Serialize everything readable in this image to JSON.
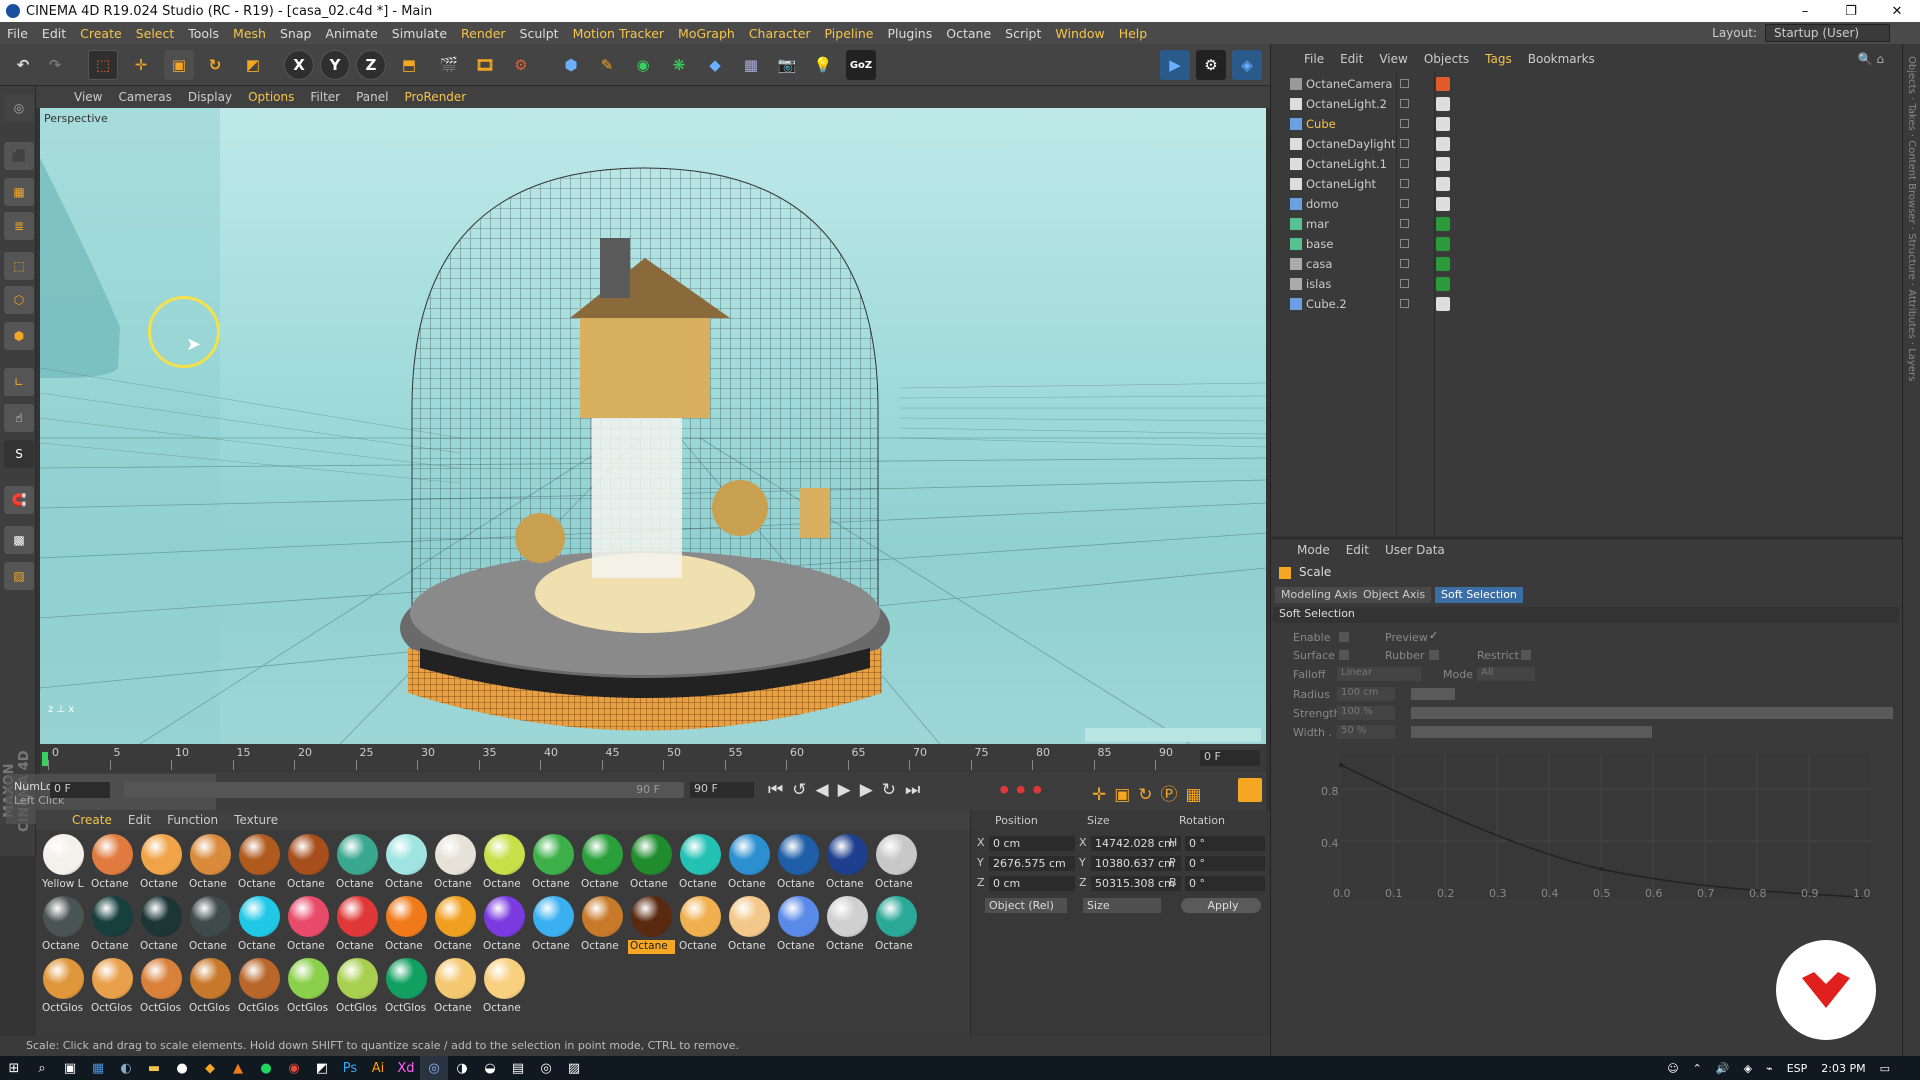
{
  "window": {
    "title": "CINEMA 4D R19.024 Studio (RC - R19) - [casa_02.c4d *] - Main",
    "min": "–",
    "max": "❐",
    "close": "✕"
  },
  "menu": [
    "File",
    "Edit",
    "Create",
    "Select",
    "Tools",
    "Mesh",
    "Snap",
    "Animate",
    "Simulate",
    "Render",
    "Sculpt",
    "Motion Tracker",
    "MoGraph",
    "Character",
    "Pipeline",
    "Plugins",
    "Octane",
    "Script",
    "Window",
    "Help"
  ],
  "layout": {
    "label": "Layout:",
    "value": "Startup (User)"
  },
  "toolbar": {
    "x": "X",
    "y": "Y",
    "z": "Z"
  },
  "viewport": {
    "menu": [
      "View",
      "Cameras",
      "Display",
      "Options",
      "Filter",
      "Panel",
      "ProRender"
    ],
    "label": "Perspective"
  },
  "timeline": {
    "ticks": [
      "0",
      "5",
      "10",
      "15",
      "20",
      "25",
      "30",
      "35",
      "40",
      "45",
      "50",
      "55",
      "60",
      "65",
      "70",
      "75",
      "80",
      "85",
      "90"
    ],
    "frame_field": "0 F",
    "start_field": "0 F",
    "end_field": "90 F",
    "end_field2": "90 F",
    "numlock": "NumLock",
    "leftclick": "Left Click"
  },
  "materials": {
    "menu": [
      "Create",
      "Edit",
      "Function",
      "Texture"
    ],
    "rows": [
      [
        {
          "n": "Yellow L",
          "c": "#f4f0ea"
        },
        {
          "n": "Octane",
          "c": "#e07a3e"
        },
        {
          "n": "Octane",
          "c": "#f0a347"
        },
        {
          "n": "Octane",
          "c": "#d98a3a"
        },
        {
          "n": "Octane",
          "c": "#b05a1e"
        },
        {
          "n": "Octane",
          "c": "#a74e1c"
        },
        {
          "n": "Octane",
          "c": "#3aa890"
        },
        {
          "n": "Octane",
          "c": "#9fe4e2"
        },
        {
          "n": "Octane",
          "c": "#e6e2d8"
        },
        {
          "n": "Octane",
          "c": "#c7e04a"
        },
        {
          "n": "Octane",
          "c": "#3db04a"
        },
        {
          "n": "Octane",
          "c": "#2aa03a"
        },
        {
          "n": "Octane",
          "c": "#1f8c2e"
        },
        {
          "n": "Octane",
          "c": "#23c2b4"
        },
        {
          "n": "Octane",
          "c": "#2b8fd0"
        },
        {
          "n": "Octane",
          "c": "#1f5ea8"
        },
        {
          "n": "Octane",
          "c": "#1d3f8e"
        },
        {
          "n": "Octane",
          "c": "#c8c8c8"
        }
      ],
      [
        {
          "n": "Octane",
          "c": "#4a5452"
        },
        {
          "n": "Octane",
          "c": "#163f3e"
        },
        {
          "n": "Octane",
          "c": "#1b3635"
        },
        {
          "n": "Octane",
          "c": "#3f4a4a"
        },
        {
          "n": "Octane",
          "c": "#20c8e6"
        },
        {
          "n": "Octane",
          "c": "#e84a6a"
        },
        {
          "n": "Octane",
          "c": "#e03838"
        },
        {
          "n": "Octane",
          "c": "#f07a1a"
        },
        {
          "n": "Octane",
          "c": "#f0a020"
        },
        {
          "n": "Octane",
          "c": "#7a3ae0"
        },
        {
          "n": "Octane",
          "c": "#3ab0f0"
        },
        {
          "n": "Octane",
          "c": "#c87a2a"
        },
        {
          "n": "Octane",
          "c": "#5a2a10",
          "sel": true
        },
        {
          "n": "Octane",
          "c": "#f0b050"
        },
        {
          "n": "Octane",
          "c": "#f4c88a"
        },
        {
          "n": "Octane",
          "c": "#5a8ae8"
        },
        {
          "n": "Octane",
          "c": "#d0d0d0"
        },
        {
          "n": "Octane",
          "c": "#2aa898"
        }
      ],
      [
        {
          "n": "OctGlos",
          "c": "#e0963a"
        },
        {
          "n": "OctGlos",
          "c": "#e8a04a"
        },
        {
          "n": "OctGlos",
          "c": "#d9803a"
        },
        {
          "n": "OctGlos",
          "c": "#c8782a"
        },
        {
          "n": "OctGlos",
          "c": "#b8662a"
        },
        {
          "n": "OctGlos",
          "c": "#8ad04a"
        },
        {
          "n": "OctGlos",
          "c": "#a8d050"
        },
        {
          "n": "OctGlos",
          "c": "#12a060"
        },
        {
          "n": "Octane",
          "c": "#f4c870"
        },
        {
          "n": "Octane",
          "c": "#f8d080"
        }
      ]
    ]
  },
  "coords": {
    "headers": [
      "Position",
      "Size",
      "Rotation"
    ],
    "rows": [
      {
        "a": "X",
        "pos": "0 cm",
        "b": "X",
        "size": "14742.028 cm",
        "c": "H",
        "rot": "0 °"
      },
      {
        "a": "Y",
        "pos": "2676.575 cm",
        "b": "Y",
        "size": "10380.637 cm",
        "c": "P",
        "rot": "0 °"
      },
      {
        "a": "Z",
        "pos": "0 cm",
        "b": "Z",
        "size": "50315.308 cm",
        "c": "B",
        "rot": "0 °"
      }
    ],
    "mode": "Object (Rel)",
    "size_mode": "Size",
    "apply": "Apply"
  },
  "objects": {
    "menu": [
      "File",
      "Edit",
      "View",
      "Objects",
      "Tags",
      "Bookmarks"
    ],
    "items": [
      {
        "name": "OctaneCamera",
        "color": "#ccc",
        "icon": "#999"
      },
      {
        "name": "OctaneLight.2",
        "color": "#ccc",
        "icon": "#ddd"
      },
      {
        "name": "Cube",
        "color": "#f5c44a",
        "icon": "#6aa0e0"
      },
      {
        "name": "OctaneDaylight",
        "color": "#ccc",
        "icon": "#ddd"
      },
      {
        "name": "OctaneLight.1",
        "color": "#ccc",
        "icon": "#ddd"
      },
      {
        "name": "OctaneLight",
        "color": "#ccc",
        "icon": "#ddd"
      },
      {
        "name": "domo",
        "color": "#ccc",
        "icon": "#6aa0e0"
      },
      {
        "name": "mar",
        "color": "#ccc",
        "icon": "#5ac090"
      },
      {
        "name": "base",
        "color": "#ccc",
        "icon": "#5ac090"
      },
      {
        "name": "casa",
        "color": "#ccc",
        "icon": "#aaa"
      },
      {
        "name": "islas",
        "color": "#ccc",
        "icon": "#aaa"
      },
      {
        "name": "Cube.2",
        "color": "#ccc",
        "icon": "#6aa0e0"
      }
    ]
  },
  "attributes": {
    "menu": [
      "Mode",
      "Edit",
      "User Data"
    ],
    "title": "Scale",
    "tabs": [
      "Modeling Axis",
      "Object Axis",
      "Soft Selection"
    ],
    "section": "Soft Selection",
    "enable": "Enable",
    "preview": "Preview",
    "surface": "Surface",
    "rubber": "Rubber",
    "restrict": "Restrict",
    "falloff": "Falloff",
    "falloff_val": "Linear",
    "mode": "Mode",
    "mode_val": "All",
    "radius": "Radius",
    "radius_val": "100 cm",
    "strength": "Strength",
    "strength_val": "100 %",
    "width": "Width . .",
    "width_val": "50 %",
    "graph_y": [
      "0.8",
      "0.4"
    ],
    "graph_x": [
      "0.0",
      "0.1",
      "0.2",
      "0.3",
      "0.4",
      "0.5",
      "0.6",
      "0.7",
      "0.8",
      "0.9",
      "1.0"
    ]
  },
  "status": "Scale: Click and drag to scale elements. Hold down SHIFT to quantize scale / add to the selection in point mode, CTRL to remove.",
  "taskbar": {
    "lang": "ESP",
    "time": "2:03 PM"
  }
}
